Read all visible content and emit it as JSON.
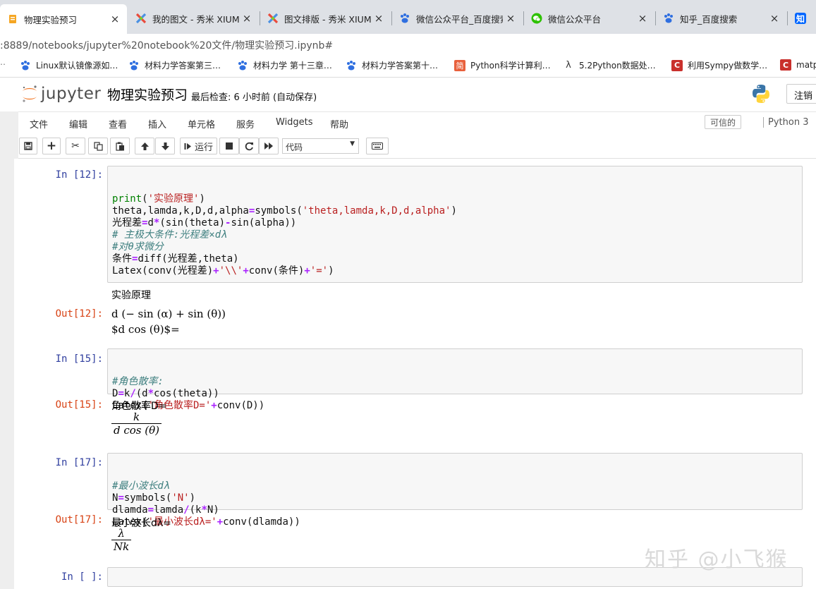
{
  "browser": {
    "tabs": [
      {
        "label": "物理实验预习",
        "icon": "notebook-icon",
        "active": true
      },
      {
        "label": "我的图文 - 秀米 XIUMI",
        "icon": "xiumi-icon",
        "active": false
      },
      {
        "label": "图文排版 - 秀米 XIUMI",
        "icon": "xiumi-icon",
        "active": false
      },
      {
        "label": "微信公众平台_百度搜索",
        "icon": "baidu-icon",
        "active": false
      },
      {
        "label": "微信公众平台",
        "icon": "wechat-icon",
        "active": false
      },
      {
        "label": "知乎_百度搜索",
        "icon": "baidu-icon",
        "active": false
      },
      {
        "label": "知",
        "icon": "zhihu-icon",
        "active": false
      }
    ],
    "close_glyph": "×",
    "url": ":8889/notebooks/jupyter%20notebook%20文件/物理实验预习.ipynb#",
    "bookmarks": [
      {
        "label": "Linux默认镜像源如…",
        "icon": "baidu-icon"
      },
      {
        "label": "材料力学答案第三…",
        "icon": "baidu-icon"
      },
      {
        "label": "材料力学 第十三章…",
        "icon": "baidu-icon"
      },
      {
        "label": "材料力学答案第十…",
        "icon": "baidu-icon"
      },
      {
        "label": "Python科学计算利…",
        "icon": "jianshu-icon"
      },
      {
        "label": "5.2Python数据处…",
        "icon": "lambda-icon"
      },
      {
        "label": "利用Sympy做数学…",
        "icon": "csdn-icon"
      },
      {
        "label": "matp",
        "icon": "csdn-icon"
      }
    ]
  },
  "jupyter": {
    "logo_text": "jupyter",
    "notebook_title": "物理实验预习",
    "checkpoint": "最后检查: 6 小时前   (自动保存)",
    "logout_label": "注销",
    "menu": [
      "文件",
      "编辑",
      "查看",
      "插入",
      "单元格",
      "服务",
      "Widgets",
      "帮助"
    ],
    "trusted_label": "可信的",
    "kernel_label": "Python 3",
    "run_label": "运行",
    "cell_type": "代码"
  },
  "cells": [
    {
      "prompt_in": "In [12]:",
      "code": [
        [
          [
            "fn",
            "print"
          ],
          [
            "p",
            "("
          ],
          [
            "str",
            "'实验原理'"
          ],
          [
            "p",
            ")"
          ]
        ],
        [
          [
            "p",
            "theta,lamda,k,D,d,alpha"
          ],
          [
            "op",
            "="
          ],
          [
            "p",
            "symbols("
          ],
          [
            "str",
            "'theta,lamda,k,D,d,alpha'"
          ],
          [
            "p",
            ")"
          ]
        ],
        [
          [
            "p",
            "光程差"
          ],
          [
            "op",
            "="
          ],
          [
            "p",
            "d"
          ],
          [
            "op",
            "*"
          ],
          [
            "p",
            "(sin(theta)"
          ],
          [
            "op",
            "-"
          ],
          [
            "p",
            "sin(alpha))"
          ]
        ],
        [
          [
            "com",
            "# 主极大条件:光程差×dλ"
          ]
        ],
        [
          [
            "com",
            "#对θ求微分"
          ]
        ],
        [
          [
            "p",
            "条件"
          ],
          [
            "op",
            "="
          ],
          [
            "p",
            "diff(光程差,theta)"
          ]
        ],
        [
          [
            "p",
            "Latex(conv(光程差)"
          ],
          [
            "op",
            "+"
          ],
          [
            "str",
            "'\\\\'"
          ],
          [
            "op",
            "+"
          ],
          [
            "p",
            "conv(条件)"
          ],
          [
            "op",
            "+"
          ],
          [
            "str",
            "'='"
          ],
          [
            "p",
            ")"
          ]
        ]
      ],
      "stdout": "实验原理",
      "prompt_out": "Out[12]:",
      "math_line1": "d (− sin (α) + sin (θ))",
      "math_line2": "$d cos (θ)$="
    },
    {
      "prompt_in": "In [15]:",
      "code": [
        [
          [
            "com",
            "#角色散率:"
          ]
        ],
        [
          [
            "p",
            "D"
          ],
          [
            "op",
            "="
          ],
          [
            "p",
            "k"
          ],
          [
            "op",
            "/"
          ],
          [
            "p",
            "(d"
          ],
          [
            "op",
            "*"
          ],
          [
            "p",
            "cos(theta))"
          ]
        ],
        [
          [
            "p",
            "Latex("
          ],
          [
            "str",
            "'角色散率D='"
          ],
          [
            "op",
            "+"
          ],
          [
            "p",
            "conv(D))"
          ]
        ]
      ],
      "prompt_out": "Out[15]:",
      "out_label": "角色散率D=",
      "frac_num": "k",
      "frac_den": "d cos (θ)"
    },
    {
      "prompt_in": "In [17]:",
      "code": [
        [
          [
            "com",
            "#最小波长dλ"
          ]
        ],
        [
          [
            "p",
            "N"
          ],
          [
            "op",
            "="
          ],
          [
            "p",
            "symbols("
          ],
          [
            "str",
            "'N'"
          ],
          [
            "p",
            ")"
          ]
        ],
        [
          [
            "p",
            "dlamda"
          ],
          [
            "op",
            "="
          ],
          [
            "p",
            "lamda"
          ],
          [
            "op",
            "/"
          ],
          [
            "p",
            "(k"
          ],
          [
            "op",
            "*"
          ],
          [
            "p",
            "N)"
          ]
        ],
        [
          [
            "p",
            "Latex("
          ],
          [
            "str",
            "'最小波长dλ='"
          ],
          [
            "op",
            "+"
          ],
          [
            "p",
            "conv(dlamda))"
          ]
        ]
      ],
      "prompt_out": "Out[17]:",
      "out_label": "最小波长dλ=",
      "frac_num": "λ",
      "frac_den": "Nk"
    },
    {
      "prompt_in": "In [ ]:"
    }
  ],
  "watermark": "知乎 @小飞猴"
}
